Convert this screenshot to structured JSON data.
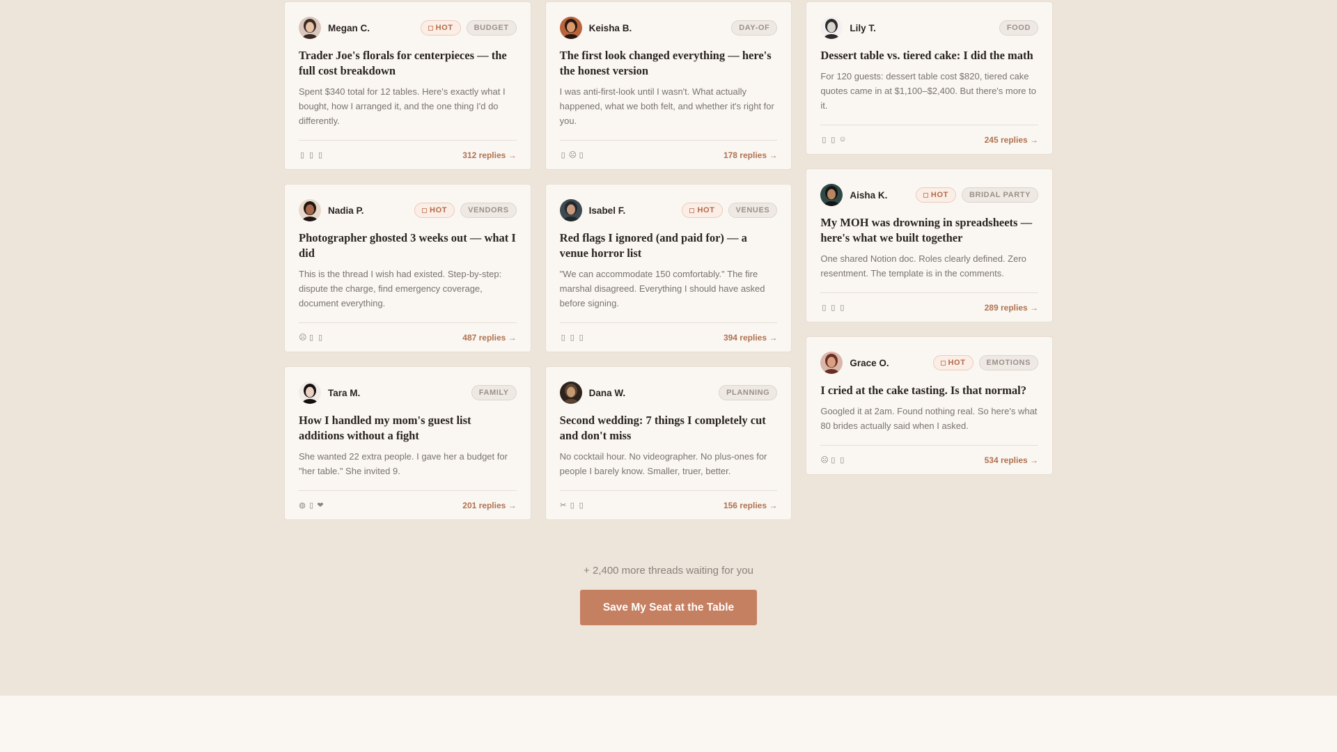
{
  "columns": [
    [
      {
        "author": "Megan C.",
        "avatar": {
          "bg": "#d9c6bd",
          "skin": "#e7c3a8",
          "hair": "#3b2a22"
        },
        "tags": [
          {
            "label": "HOT",
            "hot": true
          },
          {
            "label": "BUDGET",
            "hot": false
          }
        ],
        "title": "Trader Joe's florals for centerpieces — the full cost breakdown",
        "body": "Spent $340 total for 12 tables. Here's exactly what I bought, how I arranged it, and the one thing I'd do differently.",
        "reactions": [
          "▯",
          "▯",
          "▯"
        ],
        "replies": "312 replies →"
      },
      {
        "author": "Nadia P.",
        "avatar": {
          "bg": "#e8d9cc",
          "skin": "#a8684a",
          "hair": "#1f1410"
        },
        "tags": [
          {
            "label": "HOT",
            "hot": true
          },
          {
            "label": "VENDORS",
            "hot": false
          }
        ],
        "title": "Photographer ghosted 3 weeks out — what I did",
        "body": "This is the thread I wish had existed. Step-by-step: dispute the charge, find emergency coverage, document everything.",
        "reactions": [
          "☹",
          "▯",
          "▯"
        ],
        "replies": "487 replies →"
      },
      {
        "author": "Tara M.",
        "avatar": {
          "bg": "#f0ece8",
          "skin": "#e9d0c2",
          "hair": "#151010"
        },
        "tags": [
          {
            "label": "FAMILY",
            "hot": false
          }
        ],
        "title": "How I handled my mom's guest list additions without a fight",
        "body": "She wanted 22 extra people. I gave her a budget for \"her table.\" She invited 9.",
        "reactions": [
          "◍",
          "▯",
          "❤"
        ],
        "replies": "201 replies →"
      }
    ],
    [
      {
        "author": "Keisha B.",
        "avatar": {
          "bg": "#b8643c",
          "skin": "#d99a6e",
          "hair": "#2a1710"
        },
        "tags": [
          {
            "label": "DAY-OF",
            "hot": false
          }
        ],
        "title": "The first look changed everything — here's the honest version",
        "body": "I was anti-first-look until I wasn't. What actually happened, what we both felt, and whether it's right for you.",
        "reactions": [
          "▯",
          "☹",
          "▯"
        ],
        "replies": "178 replies →"
      },
      {
        "author": "Isabel F.",
        "avatar": {
          "bg": "#3e4a50",
          "skin": "#c79a7e",
          "hair": "#20272b"
        },
        "tags": [
          {
            "label": "HOT",
            "hot": true
          },
          {
            "label": "VENUES",
            "hot": false
          }
        ],
        "title": "Red flags I ignored (and paid for) — a venue horror list",
        "body": "\"We can accommodate 150 comfortably.\" The fire marshal disagreed. Everything I should have asked before signing.",
        "reactions": [
          "▯",
          "▯",
          "▯"
        ],
        "replies": "394 replies →"
      },
      {
        "author": "Dana W.",
        "avatar": {
          "bg": "#2c231c",
          "skin": "#c59a72",
          "hair": "#5a4332"
        },
        "tags": [
          {
            "label": "PLANNING",
            "hot": false
          }
        ],
        "title": "Second wedding: 7 things I completely cut and don't miss",
        "body": "No cocktail hour. No videographer. No plus-ones for people I barely know. Smaller, truer, better.",
        "reactions": [
          "✂",
          "▯",
          "▯"
        ],
        "replies": "156 replies →"
      }
    ],
    [
      {
        "author": "Lily T.",
        "avatar": {
          "bg": "#f3f1ef",
          "skin": "#d8d4d0",
          "hair": "#2b2b2b"
        },
        "tags": [
          {
            "label": "FOOD",
            "hot": false
          }
        ],
        "title": "Dessert table vs. tiered cake: I did the math",
        "body": "For 120 guests: dessert table cost $820, tiered cake quotes came in at $1,100–$2,400. But there's more to it.",
        "reactions": [
          "▯",
          "▯",
          "☺"
        ],
        "replies": "245 replies →"
      },
      {
        "author": "Aisha K.",
        "avatar": {
          "bg": "#2f4a44",
          "skin": "#b98563",
          "hair": "#141414"
        },
        "tags": [
          {
            "label": "HOT",
            "hot": true
          },
          {
            "label": "BRIDAL PARTY",
            "hot": false
          }
        ],
        "title": "My MOH was drowning in spreadsheets — here's what we built together",
        "body": "One shared Notion doc. Roles clearly defined. Zero resentment. The template is in the comments.",
        "reactions": [
          "▯",
          "▯",
          "▯"
        ],
        "replies": "289 replies →"
      },
      {
        "author": "Grace O.",
        "avatar": {
          "bg": "#d9b6a8",
          "skin": "#d9a184",
          "hair": "#6b2d22"
        },
        "tags": [
          {
            "label": "HOT",
            "hot": true
          },
          {
            "label": "EMOTIONS",
            "hot": false
          }
        ],
        "title": "I cried at the cake tasting. Is that normal?",
        "body": "Googled it at 2am. Found nothing real. So here's what 80 brides actually said when I asked.",
        "reactions": [
          "☹",
          "▯",
          "▯"
        ],
        "replies": "534 replies →"
      }
    ]
  ],
  "more_threads": "+ 2,400 more threads waiting for you",
  "cta_label": "Save My Seat at the Table"
}
